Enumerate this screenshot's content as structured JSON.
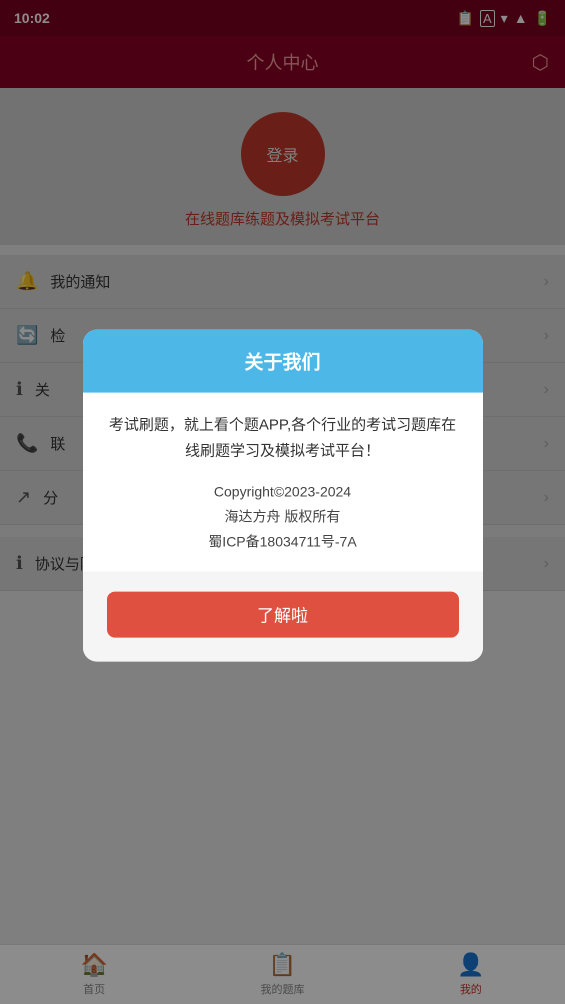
{
  "statusBar": {
    "time": "10:02"
  },
  "header": {
    "title": "个人中心"
  },
  "profile": {
    "loginLabel": "登录",
    "platformText": "在线题库练题及模拟考试平台"
  },
  "menuItems": [
    {
      "icon": "🔔",
      "label": "我的通知"
    },
    {
      "icon": "🔄",
      "label": "检"
    },
    {
      "icon": "ℹ",
      "label": "关"
    },
    {
      "icon": "📞",
      "label": "联"
    },
    {
      "icon": "↗",
      "label": "分"
    }
  ],
  "lastMenuItem": {
    "icon": "ℹ",
    "label": "协议与隐私政策"
  },
  "modal": {
    "title": "关于我们",
    "description": "考试刷题，就上看个题APP,各个行业的考试习题库在线刷题学习及模拟考试平台！",
    "copyright": "Copyright©2023-2024\n海达方舟 版权所有\n蜀ICP备18034711号-7A",
    "buttonLabel": "了解啦"
  },
  "bottomNav": [
    {
      "icon": "🏠",
      "label": "首页",
      "active": false
    },
    {
      "icon": "📋",
      "label": "我的题库",
      "active": false
    },
    {
      "icon": "👤",
      "label": "我的",
      "active": true
    }
  ]
}
